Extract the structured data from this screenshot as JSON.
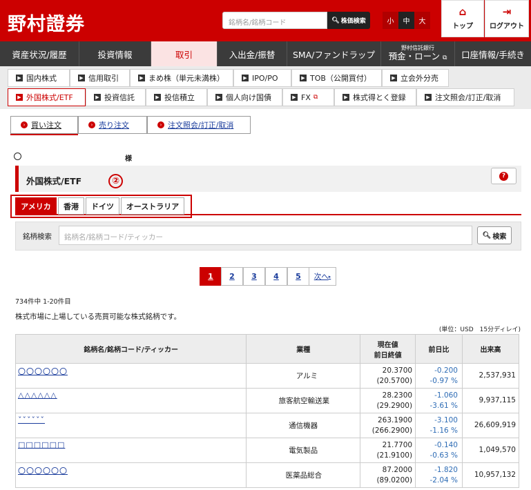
{
  "header": {
    "logo": "野村證券",
    "search_placeholder": "銘柄名/銘柄コード",
    "search_button": "株価検索",
    "font_sizes": [
      "小",
      "中",
      "大"
    ],
    "top_label": "トップ",
    "logout_label": "ログアウト"
  },
  "main_nav": [
    "資産状況/履歴",
    "投資情報",
    "取引",
    "入出金/振替",
    "SMA/ファンドラップ",
    {
      "small": "野村信託銀行",
      "label": "預金・ローン"
    },
    "口座情報/手続き"
  ],
  "sub_nav": {
    "row1": [
      "国内株式",
      "信用取引",
      "まめ株（単元未満株）",
      "IPO/PO",
      "TOB（公開買付）",
      "立会外分売"
    ],
    "row2": [
      "外国株式/ETF",
      "投資信託",
      "投信積立",
      "個人向け国債",
      "FX",
      "株式得とく登録",
      "注文照会/訂正/取消"
    ]
  },
  "order_tabs": [
    "買い注文",
    "売り注文",
    "注文照会/訂正/取消"
  ],
  "user": {
    "suffix": "様"
  },
  "page_title": "外国株式/ETF",
  "annotation_mark": "②",
  "country_tabs": [
    "アメリカ",
    "香港",
    "ドイツ",
    "オーストラリア"
  ],
  "search": {
    "label": "銘柄検索",
    "placeholder": "銘柄名/銘柄コード/ティッカー",
    "button": "検索"
  },
  "pagination": {
    "pages": [
      "1",
      "2",
      "3",
      "4",
      "5"
    ],
    "next": "次へ"
  },
  "result_count": "734件中 1-20件目",
  "description": "株式市場に上場している売買可能な株式銘柄です。",
  "unit_note": "(単位：USD　15分ディレイ)",
  "table": {
    "headers": {
      "name": "銘柄名/銘柄コード/ティッカー",
      "industry": "業種",
      "price_1": "現在値",
      "price_2": "前日終値",
      "change": "前日比",
      "volume": "出来高"
    },
    "rows": [
      {
        "name": "〇〇〇〇〇〇",
        "industry": "アルミ",
        "price": "20.3700",
        "prev": "(20.5700)",
        "chg": "-0.200",
        "pct": "-0.97 %",
        "volume": "2,537,931"
      },
      {
        "name": "△△△△△△",
        "industry": "旅客航空輸送業",
        "price": "28.2300",
        "prev": "(29.2900)",
        "chg": "-1.060",
        "pct": "-3.61 %",
        "volume": "9,937,115"
      },
      {
        "name": "ˇˇˇˇˇˇ",
        "industry": "通信機器",
        "price": "263.1900",
        "prev": "(266.2900)",
        "chg": "-3.100",
        "pct": "-1.16 %",
        "volume": "26,609,919"
      },
      {
        "name": "□□□□□□",
        "industry": "電気製品",
        "price": "21.7700",
        "prev": "(21.9100)",
        "chg": "-0.140",
        "pct": "-0.63 %",
        "volume": "1,049,570"
      },
      {
        "name": "〇〇〇〇〇〇",
        "industry": "医薬品総合",
        "price": "87.2000",
        "prev": "(89.0200)",
        "chg": "-1.820",
        "pct": "-2.04 %",
        "volume": "10,957,132"
      }
    ]
  }
}
